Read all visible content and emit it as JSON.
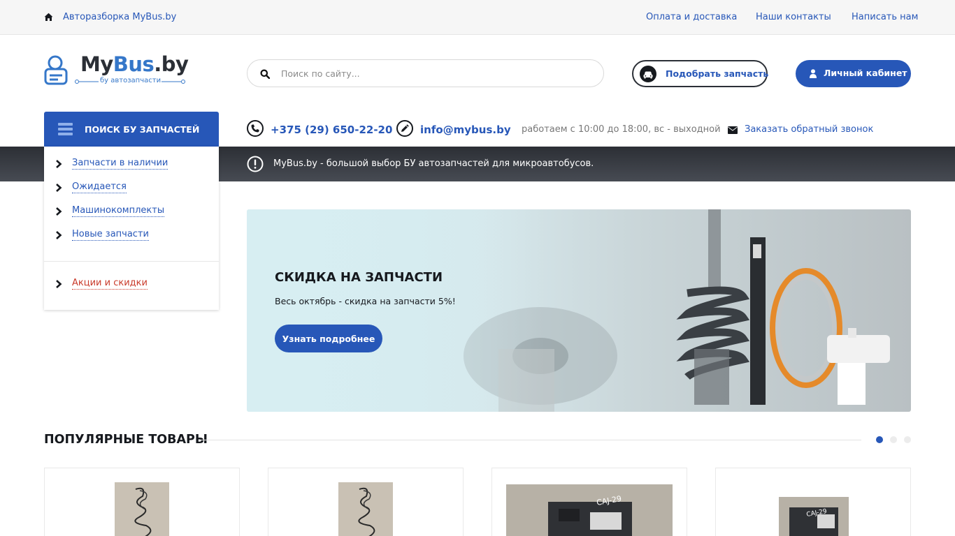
{
  "topbar": {
    "breadcrumb": "Авторазборка MyBus.by",
    "links": [
      "Оплата и доставка",
      "Наши контакты",
      "Написать нам"
    ]
  },
  "header": {
    "logo_main_a": "My",
    "logo_main_b": "Bus",
    "logo_main_c": ".by",
    "logo_sub": "бу автозапчасти",
    "search_placeholder": "Поиск по сайту...",
    "pick_button": "Подобрать запчасть",
    "cabinet_button": "Личный кабинет"
  },
  "contacts": {
    "phone": "+375 (29) 650-22-20",
    "email": "info@mybus.by",
    "hours": "работаем с 10:00 до 18:00, вс - выходной",
    "callback": "Заказать обратный звонок"
  },
  "notice": "MyBus.by - большой выбор БУ автозапчастей для микроавтобусов.",
  "catalog": {
    "title": "ПОИСК БУ ЗАПЧАСТЕЙ",
    "items": [
      "Запчасти в наличии",
      "Ожидается",
      "Машинокомплекты",
      "Новые запчасти"
    ],
    "promo": "Акции и скидки"
  },
  "hero": {
    "title": "СКИДКА НА ЗАПЧАСТИ",
    "subtitle": "Весь октябрь - скидка на запчасти 5%!",
    "button": "Узнать подробнее"
  },
  "popular": {
    "title": "ПОПУЛЯРНЫЕ ТОВАРЫ",
    "pager_active": 1,
    "pager_total": 3
  },
  "colors": {
    "accent": "#2757b8",
    "promo_red": "#c93a2a",
    "dark_band": "#2c2f35"
  },
  "icons": [
    "home-icon",
    "search-icon",
    "car-icon",
    "user-icon",
    "phone-icon",
    "pencil-icon",
    "envelope-icon",
    "exclamation-icon",
    "menu-icon",
    "chevron-right-icon"
  ]
}
